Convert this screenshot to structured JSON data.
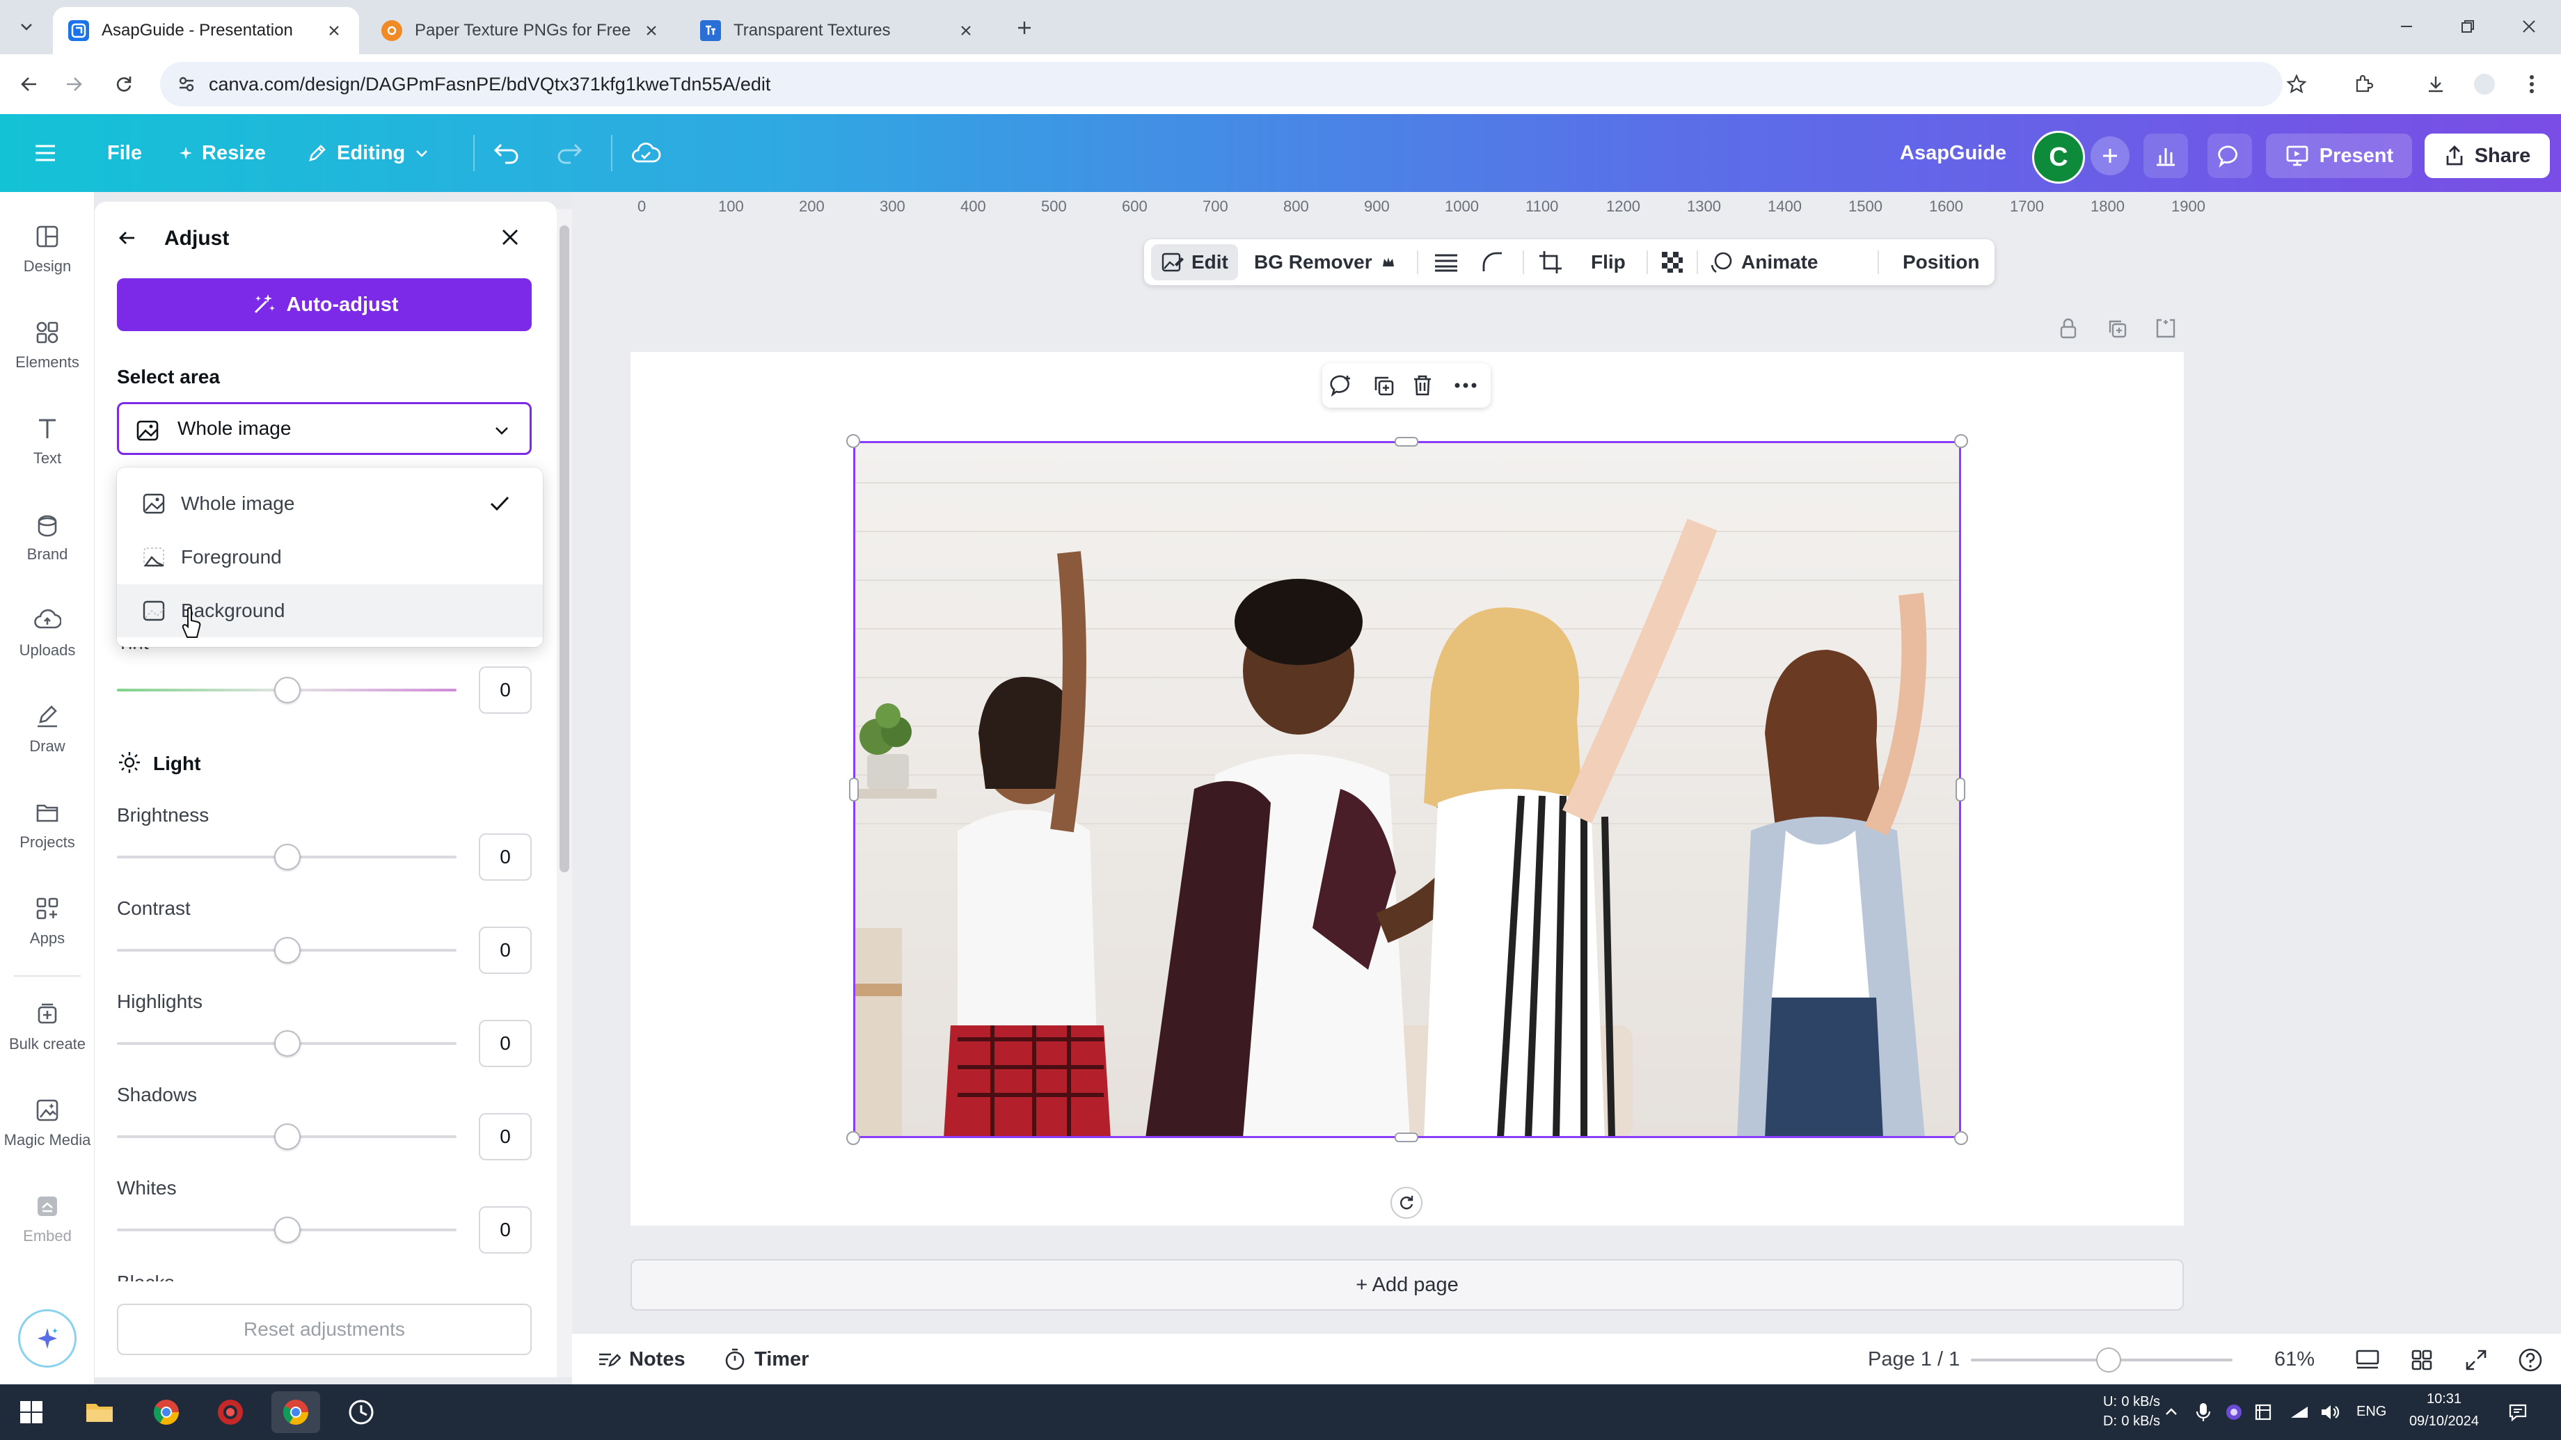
{
  "browser": {
    "tabs": [
      {
        "title": "AsapGuide - Presentation",
        "active": true
      },
      {
        "title": "Paper Texture PNGs for Free Do",
        "active": false
      },
      {
        "title": "Transparent Textures",
        "active": false
      }
    ],
    "url": "canva.com/design/DAGPmFasnPE/bdVQtx371kfg1kweTdn55A/edit"
  },
  "header": {
    "file_label": "File",
    "resize_label": "Resize",
    "editing_label": "Editing",
    "project_name": "AsapGuide",
    "avatar_initial": "C",
    "present_label": "Present",
    "share_label": "Share"
  },
  "rail": [
    {
      "label": "Design",
      "icon": "design-icon"
    },
    {
      "label": "Elements",
      "icon": "elements-icon"
    },
    {
      "label": "Text",
      "icon": "text-icon"
    },
    {
      "label": "Brand",
      "icon": "brand-icon"
    },
    {
      "label": "Uploads",
      "icon": "uploads-icon"
    },
    {
      "label": "Draw",
      "icon": "draw-icon"
    },
    {
      "label": "Projects",
      "icon": "projects-icon"
    },
    {
      "label": "Apps",
      "icon": "apps-icon"
    },
    {
      "label": "Bulk create",
      "icon": "bulk-create-icon"
    },
    {
      "label": "Magic Media",
      "icon": "magic-media-icon"
    },
    {
      "label": "Embed",
      "icon": "embed-icon"
    }
  ],
  "panel": {
    "title": "Adjust",
    "auto_adjust_label": "Auto-adjust",
    "select_area_label": "Select area",
    "selected_area": "Whole image",
    "dropdown_options": [
      {
        "label": "Whole image",
        "checked": true
      },
      {
        "label": "Foreground",
        "checked": false
      },
      {
        "label": "Background",
        "checked": false
      }
    ],
    "tint_label": "Tint",
    "tint_value": "0",
    "light_heading": "Light",
    "sliders": [
      {
        "label": "Brightness",
        "value": "0"
      },
      {
        "label": "Contrast",
        "value": "0"
      },
      {
        "label": "Highlights",
        "value": "0"
      },
      {
        "label": "Shadows",
        "value": "0"
      },
      {
        "label": "Whites",
        "value": "0"
      }
    ],
    "partial_label": "Blacks",
    "reset_label": "Reset adjustments"
  },
  "ruler": [
    "0",
    "100",
    "200",
    "300",
    "400",
    "500",
    "600",
    "700",
    "800",
    "900",
    "1000",
    "1100",
    "1200",
    "1300",
    "1400",
    "1500",
    "1600",
    "1700",
    "1800",
    "1900"
  ],
  "context_toolbar": {
    "edit_label": "Edit",
    "bg_remover_label": "BG Remover",
    "flip_label": "Flip",
    "animate_label": "Animate",
    "position_label": "Position"
  },
  "canvas": {
    "add_page_label": "+ Add page"
  },
  "bottom_bar": {
    "notes_label": "Notes",
    "timer_label": "Timer",
    "page_indicator": "Page 1 / 1",
    "zoom": "61%"
  },
  "taskbar": {
    "net_up_label": "U:",
    "net_down_label": "D:",
    "net_up": "0 kB/s",
    "net_down": "0 kB/s",
    "language": "ENG",
    "time": "10:31",
    "date": "09/10/2024"
  },
  "colors": {
    "accent": "#7d2ae8",
    "selection": "#8b3dff",
    "avatar": "#0d8a3a"
  }
}
